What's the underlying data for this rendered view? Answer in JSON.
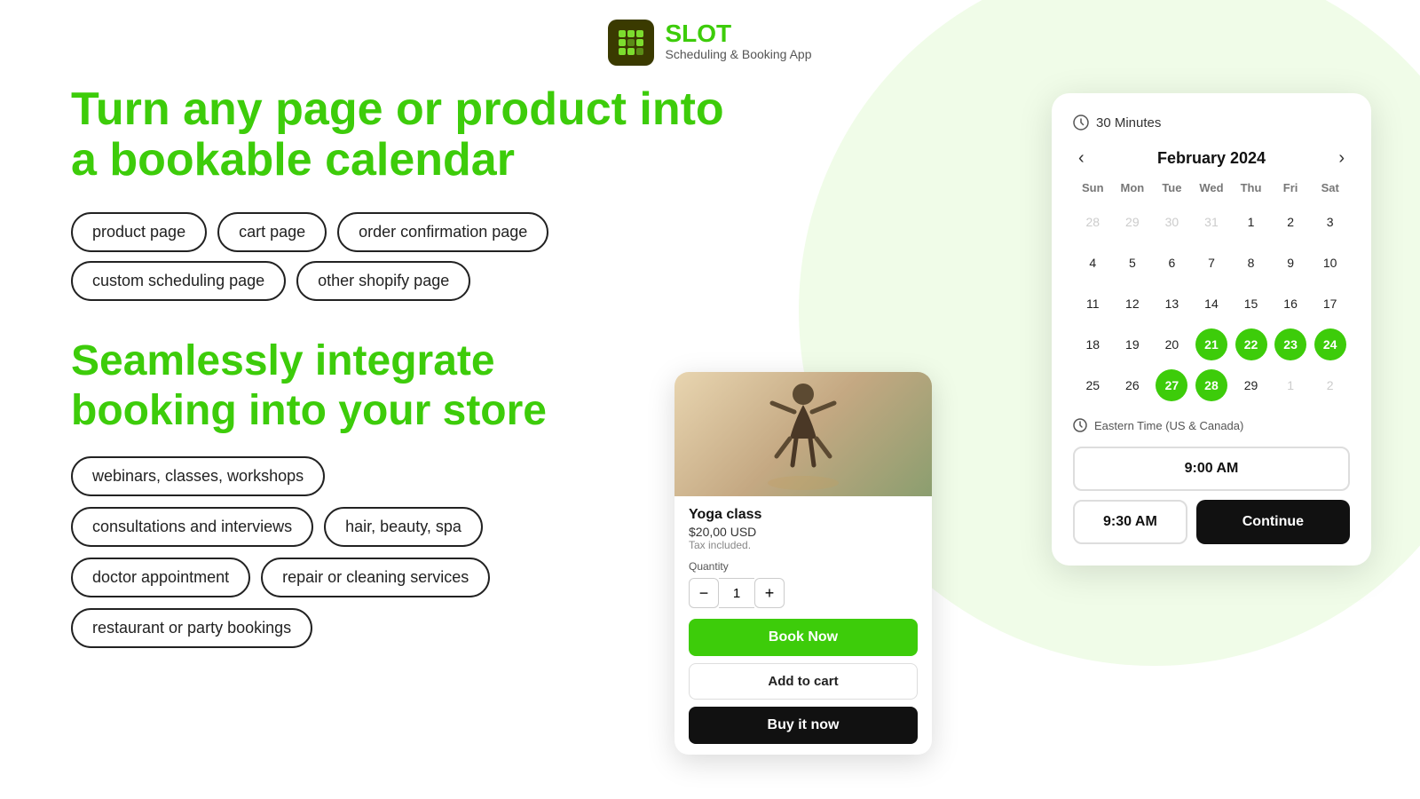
{
  "header": {
    "logo_alt": "SLOT App Logo",
    "app_name": "SLOT",
    "app_subtitle": "Scheduling & Booking App"
  },
  "hero": {
    "headline_line1": "Turn any page or product into",
    "headline_line2": "a bookable calendar",
    "tags_row1": [
      "product page",
      "cart page",
      "order confirmation page"
    ],
    "tags_row2": [
      "custom scheduling page",
      "other shopify page"
    ],
    "section2_title_line1": "Seamlessly integrate",
    "section2_title_line2": "booking into your store",
    "use_case_tags_row1": [
      "webinars, classes, workshops"
    ],
    "use_case_tags_row2": [
      "consultations and interviews",
      "hair, beauty, spa"
    ],
    "use_case_tags_row3": [
      "doctor appointment",
      "repair or cleaning services"
    ],
    "use_case_tags_row4": [
      "restaurant or party bookings"
    ]
  },
  "product_card": {
    "title": "Yoga class",
    "price": "$20,00 USD",
    "tax_note": "Tax included.",
    "quantity_label": "Quantity",
    "quantity_value": "1",
    "btn_book_now": "Book Now",
    "btn_add_cart": "Add to cart",
    "btn_buy_now": "Buy it now"
  },
  "calendar": {
    "duration": "30 Minutes",
    "month": "February 2024",
    "prev_label": "‹",
    "next_label": "›",
    "day_headers": [
      "Sun",
      "Mon",
      "Tue",
      "Wed",
      "Thu",
      "Fri",
      "Sat"
    ],
    "weeks": [
      [
        {
          "day": "28",
          "type": "other"
        },
        {
          "day": "29",
          "type": "other"
        },
        {
          "day": "30",
          "type": "other"
        },
        {
          "day": "31",
          "type": "other"
        },
        {
          "day": "1",
          "type": "normal"
        },
        {
          "day": "2",
          "type": "normal"
        },
        {
          "day": "3",
          "type": "normal"
        }
      ],
      [
        {
          "day": "4",
          "type": "normal"
        },
        {
          "day": "5",
          "type": "normal"
        },
        {
          "day": "6",
          "type": "normal"
        },
        {
          "day": "7",
          "type": "normal"
        },
        {
          "day": "8",
          "type": "normal"
        },
        {
          "day": "9",
          "type": "normal"
        },
        {
          "day": "10",
          "type": "normal"
        }
      ],
      [
        {
          "day": "11",
          "type": "normal"
        },
        {
          "day": "12",
          "type": "normal"
        },
        {
          "day": "13",
          "type": "normal"
        },
        {
          "day": "14",
          "type": "normal"
        },
        {
          "day": "15",
          "type": "normal"
        },
        {
          "day": "16",
          "type": "normal"
        },
        {
          "day": "17",
          "type": "normal"
        }
      ],
      [
        {
          "day": "18",
          "type": "normal"
        },
        {
          "day": "19",
          "type": "normal"
        },
        {
          "day": "20",
          "type": "normal"
        },
        {
          "day": "21",
          "type": "green-fill"
        },
        {
          "day": "22",
          "type": "green-fill"
        },
        {
          "day": "23",
          "type": "green-fill"
        },
        {
          "day": "24",
          "type": "green-fill"
        }
      ],
      [
        {
          "day": "25",
          "type": "normal"
        },
        {
          "day": "26",
          "type": "normal"
        },
        {
          "day": "27",
          "type": "green-fill"
        },
        {
          "day": "28",
          "type": "green-fill"
        },
        {
          "day": "29",
          "type": "normal"
        },
        {
          "day": "1",
          "type": "other"
        },
        {
          "day": "2",
          "type": "other"
        }
      ]
    ],
    "timezone_label": "Eastern Time (US & Canada)",
    "time_slot_selected": "9:00 AM",
    "time_slot_alt": "9:30 AM",
    "btn_continue": "Continue"
  }
}
